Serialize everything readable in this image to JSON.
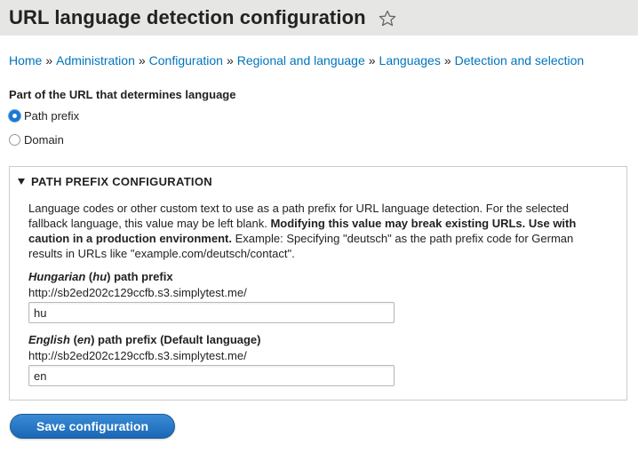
{
  "header": {
    "title": "URL language detection configuration",
    "star_icon": "star-outline-icon"
  },
  "breadcrumb": {
    "items": [
      "Home",
      "Administration",
      "Configuration",
      "Regional and language",
      "Languages",
      "Detection and selection"
    ],
    "separator": "»"
  },
  "selection": {
    "label": "Part of the URL that determines language",
    "options": [
      {
        "label": "Path prefix",
        "checked": true
      },
      {
        "label": "Domain",
        "checked": false
      }
    ]
  },
  "fieldset": {
    "legend": "PATH PREFIX CONFIGURATION",
    "description_part1": "Language codes or other custom text to use as a path prefix for URL language detection. For the selected fallback language, this value may be left blank. ",
    "description_bold": "Modifying this value may break existing URLs. Use with caution in a production environment.",
    "description_part2": " Example: Specifying \"deutsch\" as the path prefix code for German results in URLs like \"example.com/deutsch/contact\".",
    "fields": [
      {
        "lang_name": "Hungarian",
        "lang_code": "hu",
        "label_suffix": "path prefix",
        "url_prefix": "http://sb2ed202c129ccfb.s3.simplytest.me/",
        "value": "hu"
      },
      {
        "lang_name": "English",
        "lang_code": "en",
        "label_suffix": "path prefix (Default language)",
        "url_prefix": "http://sb2ed202c129ccfb.s3.simplytest.me/",
        "value": "en"
      }
    ]
  },
  "actions": {
    "save_label": "Save configuration"
  },
  "colors": {
    "link": "#0074bd",
    "primary_button": "#1967b6",
    "header_bg": "#e6e6e4"
  }
}
